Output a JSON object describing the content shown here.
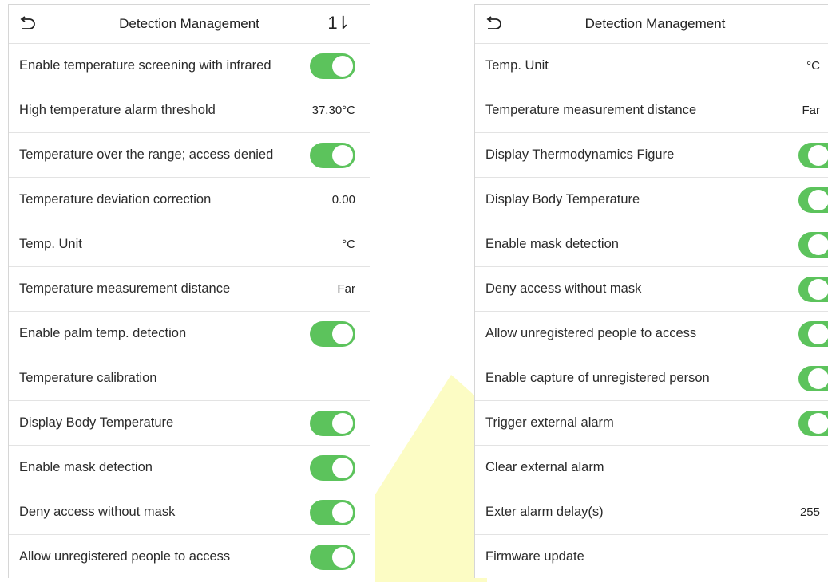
{
  "colors": {
    "toggle_on": "#5cc35c",
    "divider": "#e3e3e3",
    "watermark": "#fbfbb0"
  },
  "icons": {
    "back": "back-arrow-icon",
    "sort": "sort-arrows-icon"
  },
  "left_panel": {
    "title": "Detection Management",
    "sort_glyph": "1⇂",
    "rows": [
      {
        "label": "Enable temperature screening with infrared",
        "toggle": true
      },
      {
        "label": "High temperature alarm threshold",
        "value": "37.30°C"
      },
      {
        "label": "Temperature over the range; access denied",
        "toggle": true
      },
      {
        "label": "Temperature deviation correction",
        "value": "0.00"
      },
      {
        "label": "Temp. Unit",
        "value": "°C"
      },
      {
        "label": "Temperature measurement distance",
        "value": "Far"
      },
      {
        "label": "Enable palm temp. detection",
        "toggle": true
      },
      {
        "label": "Temperature calibration"
      },
      {
        "label": "Display Body Temperature",
        "toggle": true
      },
      {
        "label": "Enable mask detection",
        "toggle": true
      },
      {
        "label": "Deny access without mask",
        "toggle": true
      },
      {
        "label": "Allow unregistered people to access",
        "toggle": true
      }
    ]
  },
  "right_panel": {
    "title": "Detection Management",
    "rows": [
      {
        "label": "Temp. Unit",
        "value": "°C"
      },
      {
        "label": "Temperature measurement distance",
        "value": "Far"
      },
      {
        "label": "Display Thermodynamics Figure",
        "toggle": true
      },
      {
        "label": "Display Body Temperature",
        "toggle": true
      },
      {
        "label": "Enable mask detection",
        "toggle": true
      },
      {
        "label": "Deny access without mask",
        "toggle": true
      },
      {
        "label": "Allow unregistered people to access",
        "toggle": true
      },
      {
        "label": "Enable capture of unregistered person",
        "toggle": true
      },
      {
        "label": "Trigger external alarm",
        "toggle": true
      },
      {
        "label": "Clear external alarm"
      },
      {
        "label": "Exter alarm delay(s)",
        "value": "255"
      },
      {
        "label": "Firmware update"
      }
    ]
  }
}
